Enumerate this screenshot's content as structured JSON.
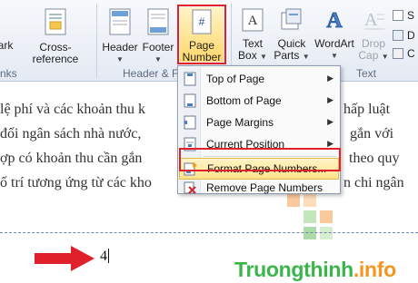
{
  "ribbon": {
    "buttons": {
      "bookmark_partial": "ark",
      "cross_reference": "Cross-reference",
      "header": "Header",
      "footer": "Footer",
      "page_number_line1": "Page",
      "page_number_line2": "Number",
      "text_box_line1": "Text",
      "text_box_line2": "Box",
      "quick_parts_line1": "Quick",
      "quick_parts_line2": "Parts",
      "wordart": "WordArt",
      "drop_cap_line1": "Drop",
      "drop_cap_line2": "Cap"
    },
    "small_items": [
      "S",
      "D",
      "C"
    ],
    "group_labels": {
      "links_partial": "nks",
      "header_footer_partial": "Header & F",
      "text": "Text"
    }
  },
  "menu": {
    "items": [
      {
        "label": "Top of Page",
        "has_submenu": true
      },
      {
        "label": "Bottom of Page",
        "has_submenu": true
      },
      {
        "label": "Page Margins",
        "has_submenu": true
      },
      {
        "label": "Current Position",
        "has_submenu": true
      },
      {
        "label": "Format Page Numbers...",
        "has_submenu": false,
        "highlighted": true
      },
      {
        "label": "Remove Page Numbers",
        "has_submenu": false
      }
    ]
  },
  "document": {
    "lines": [
      {
        "left": "lệ phí và các khoản thu k",
        "right": "hấp luật"
      },
      {
        "left": "đối ngân sách nhà nước,",
        "right": "gắn với"
      },
      {
        "left": "ợp có khoản thu cần gắn",
        "right": "theo quy"
      },
      {
        "left": "ố trí tương ứng từ các kho",
        "right": "n chi ngân"
      }
    ],
    "page_number_value": "4"
  },
  "watermark": {
    "brand_green": "Truongthinh",
    "brand_orange": ".info"
  },
  "colors": {
    "highlight_border": "#e0202a",
    "brand_green": "#39b54a",
    "brand_orange": "#f7941d"
  }
}
